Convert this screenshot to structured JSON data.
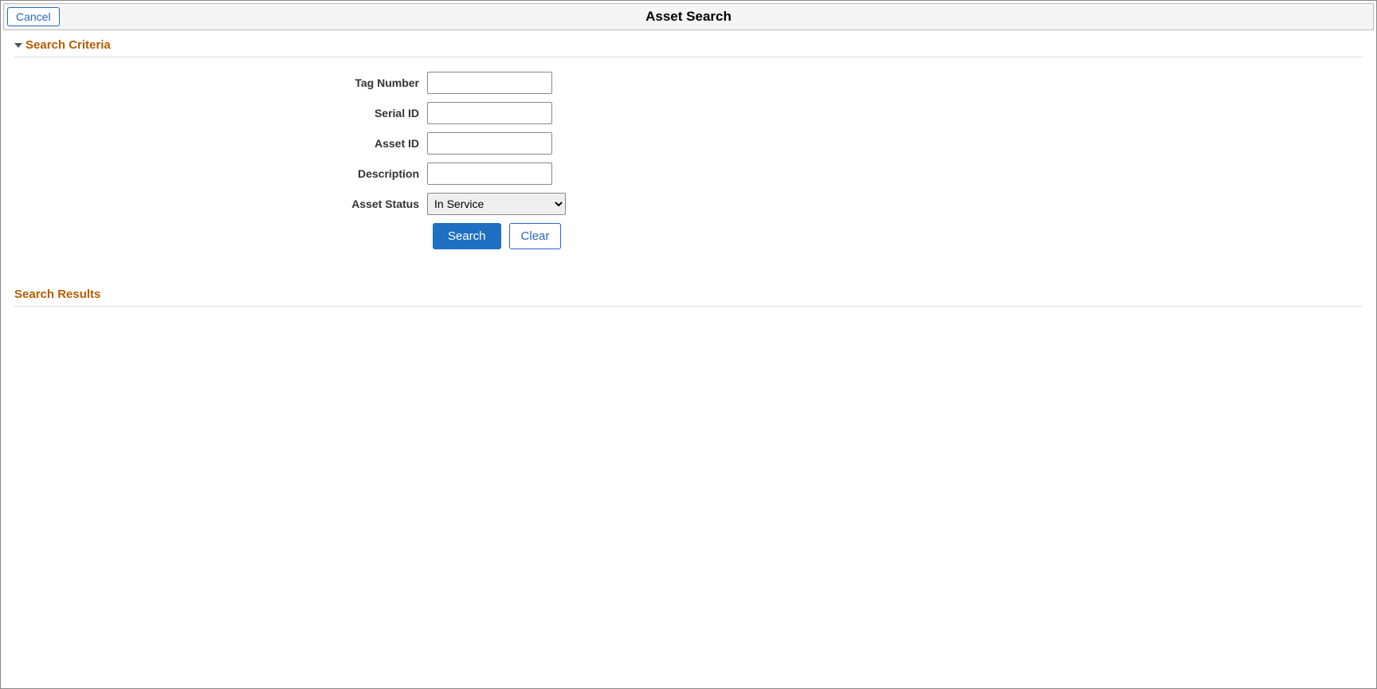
{
  "header": {
    "cancel_label": "Cancel",
    "title": "Asset Search"
  },
  "search_criteria": {
    "section_title": "Search Criteria",
    "fields": {
      "tag_number": {
        "label": "Tag Number",
        "value": ""
      },
      "serial_id": {
        "label": "Serial ID",
        "value": ""
      },
      "asset_id": {
        "label": "Asset ID",
        "value": ""
      },
      "description": {
        "label": "Description",
        "value": ""
      },
      "asset_status": {
        "label": "Asset Status",
        "selected": "In Service"
      }
    },
    "buttons": {
      "search": "Search",
      "clear": "Clear"
    }
  },
  "search_results": {
    "section_title": "Search Results"
  }
}
